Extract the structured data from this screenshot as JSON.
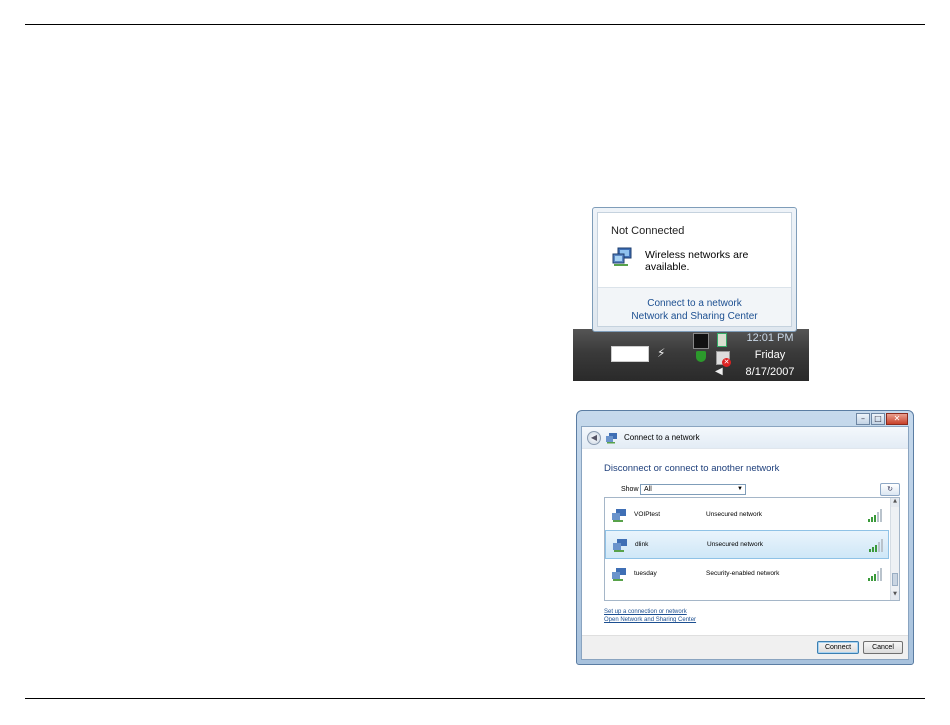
{
  "notification": {
    "title": "Not Connected",
    "message": "Wireless networks are available.",
    "links": [
      "Connect to a network",
      "Network and Sharing Center"
    ]
  },
  "taskbar": {
    "time": "12:01 PM",
    "day": "Friday",
    "date": "8/17/2007"
  },
  "dialog": {
    "window_title": "Connect to a network",
    "heading": "Disconnect or connect to another network",
    "show_label": "Show",
    "show_value": "All",
    "networks": [
      {
        "name": "VOIPtest",
        "security": "Unsecured network",
        "selected": false
      },
      {
        "name": "dlink",
        "security": "Unsecured network",
        "selected": true
      },
      {
        "name": "tuesday",
        "security": "Security-enabled network",
        "selected": false
      }
    ],
    "links": [
      "Set up a connection or network",
      "Open Network and Sharing Center"
    ],
    "connect_label": "Connect",
    "cancel_label": "Cancel"
  },
  "icons": {
    "network": "network-computer-icon",
    "signal": "signal-strength-icon",
    "refresh": "refresh-icon",
    "back": "back-arrow-icon"
  },
  "colors": {
    "link": "#1c4f91",
    "heading": "#1e3f7b",
    "selection": "#cfe7f7",
    "taskbar": "#3a3a3a"
  }
}
